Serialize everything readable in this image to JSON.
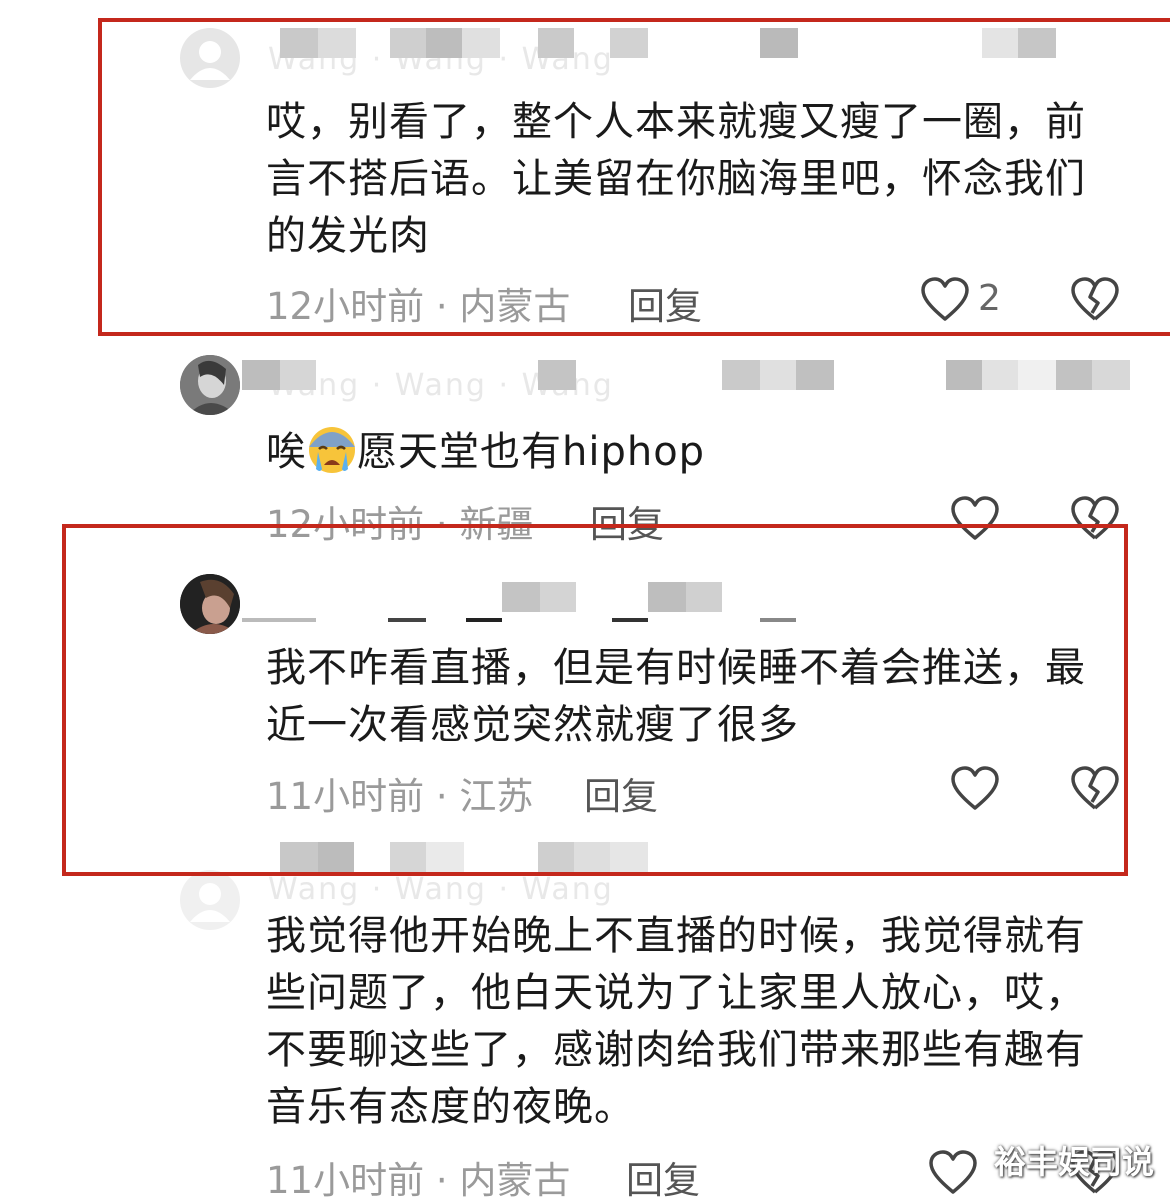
{
  "comments": [
    {
      "name_hint": "Wang · Wang · Wang",
      "text": "哎，别看了，整个人本来就瘦又瘦了一圈，前言不搭后语。让美留在你脑海里吧，怀念我们的发光肉",
      "time": "12小时前",
      "location": "内蒙古",
      "reply_label": "回复",
      "like_count": "2"
    },
    {
      "name_hint": "Wang · Wang · Wang",
      "text_prefix": "唉",
      "emoji": "crying-face",
      "text_suffix": "愿天堂也有hiphop",
      "time": "12小时前",
      "location": "新疆",
      "reply_label": "回复",
      "like_count": ""
    },
    {
      "name_hint": "",
      "text": "我不咋看直播，但是有时候睡不着会推送，最近一次看感觉突然就瘦了很多",
      "time": "11小时前",
      "location": "江苏",
      "reply_label": "回复",
      "like_count": ""
    },
    {
      "name_hint": "Wang · Wang · Wang",
      "text": "我觉得他开始晚上不直播的时候，我觉得就有些问题了，他白天说为了让家里人放心，哎，不要聊这些了，感谢肉给我们带来那些有趣有音乐有态度的夜晚。",
      "time": "11小时前",
      "location": "内蒙古",
      "reply_label": "回复",
      "like_count": ""
    }
  ],
  "meta_separator": "·",
  "watermark": "裕丰娱司说",
  "colors": {
    "highlight": "#c4281c",
    "meta": "#9a9a9a",
    "text": "#1a1a1a"
  }
}
